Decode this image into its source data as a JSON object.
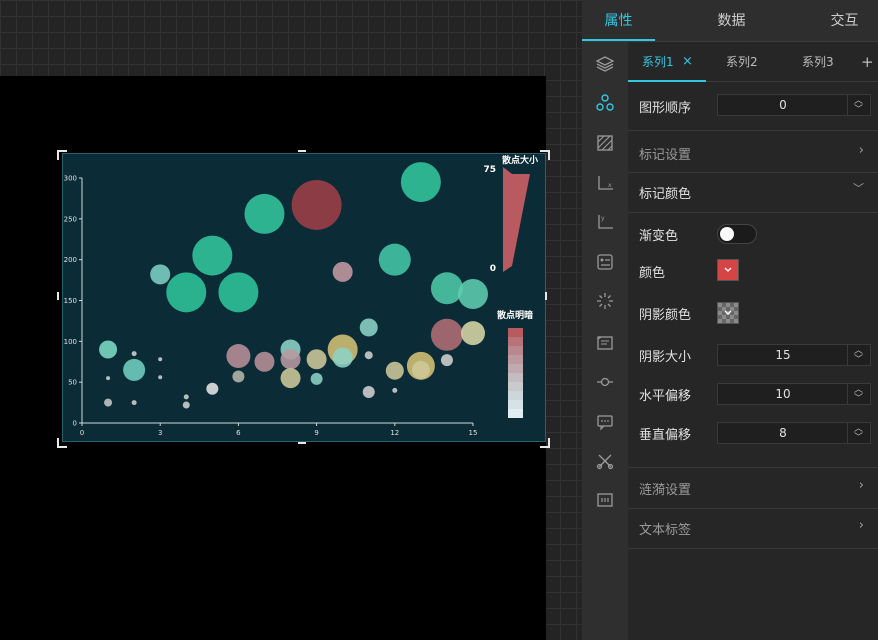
{
  "panel": {
    "tabs": [
      "属性",
      "数据",
      "交互"
    ],
    "series_tabs": [
      "系列1",
      "系列2",
      "系列3"
    ],
    "series_close": "×",
    "series_add": "+",
    "rows": {
      "order_label": "图形顺序",
      "order_value": "0",
      "mark_settings": "标记设置",
      "mark_color": "标记颜色",
      "gradient": "渐变色",
      "color": "颜色",
      "shadow_color": "阴影颜色",
      "shadow_size": "阴影大小",
      "shadow_size_value": "15",
      "h_offset": "水平偏移",
      "h_offset_value": "10",
      "v_offset": "垂直偏移",
      "v_offset_value": "8",
      "ripple": "涟漪设置",
      "text_label": "文本标签"
    },
    "colors": {
      "accent": "#33c6e0",
      "mark_color": "#d64545"
    },
    "icons": [
      "layers-icon",
      "scatter-icon",
      "texture-icon",
      "x-axis-icon",
      "y-axis-icon",
      "legend-icon",
      "loading-icon",
      "tooltip-icon",
      "slider-icon",
      "message-icon",
      "tools-icon",
      "table-icon"
    ]
  },
  "chart_data": {
    "type": "scatter",
    "xlim": [
      0,
      15
    ],
    "ylim": [
      0,
      300
    ],
    "x_ticks": [
      "0",
      "3",
      "6",
      "9",
      "12",
      "15"
    ],
    "y_ticks": [
      "0",
      "50",
      "100",
      "150",
      "200",
      "250",
      "300"
    ],
    "size_legend": {
      "title": "散点大小",
      "max": "75",
      "min": "0"
    },
    "shade_legend": {
      "title": "散点明暗"
    },
    "points": [
      {
        "x": 1,
        "y": 90,
        "size": 18,
        "color": "#7dd9c6"
      },
      {
        "x": 1,
        "y": 25,
        "size": 8,
        "color": "#c6c6c6"
      },
      {
        "x": 1,
        "y": 55,
        "size": 4,
        "color": "#d0d0d0"
      },
      {
        "x": 2,
        "y": 85,
        "size": 5,
        "color": "#d0d0d0"
      },
      {
        "x": 2,
        "y": 65,
        "size": 22,
        "color": "#6fd0c0"
      },
      {
        "x": 2,
        "y": 25,
        "size": 5,
        "color": "#d0d0d0"
      },
      {
        "x": 3,
        "y": 182,
        "size": 20,
        "color": "#7dd0c6"
      },
      {
        "x": 3,
        "y": 78,
        "size": 4,
        "color": "#d0d0d0"
      },
      {
        "x": 3,
        "y": 56,
        "size": 4,
        "color": "#d0d0d0"
      },
      {
        "x": 4,
        "y": 160,
        "size": 40,
        "color": "#2fc49a"
      },
      {
        "x": 4,
        "y": 32,
        "size": 5,
        "color": "#d0d0d0"
      },
      {
        "x": 4,
        "y": 22,
        "size": 7,
        "color": "#d0d0d0"
      },
      {
        "x": 5,
        "y": 205,
        "size": 40,
        "color": "#33c69e"
      },
      {
        "x": 5,
        "y": 42,
        "size": 12,
        "color": "#e6e6e6"
      },
      {
        "x": 6,
        "y": 160,
        "size": 40,
        "color": "#2fc49a"
      },
      {
        "x": 6,
        "y": 82,
        "size": 24,
        "color": "#b88f98"
      },
      {
        "x": 6,
        "y": 57,
        "size": 12,
        "color": "#b6b6aa"
      },
      {
        "x": 7,
        "y": 256,
        "size": 40,
        "color": "#33c69e"
      },
      {
        "x": 7,
        "y": 75,
        "size": 20,
        "color": "#b88f98"
      },
      {
        "x": 8,
        "y": 90,
        "size": 20,
        "color": "#8dd3c6"
      },
      {
        "x": 8,
        "y": 78,
        "size": 20,
        "color": "#b89aa0"
      },
      {
        "x": 8,
        "y": 55,
        "size": 20,
        "color": "#cfc89a"
      },
      {
        "x": 9,
        "y": 267,
        "size": 50,
        "color": "#9e3f48"
      },
      {
        "x": 9,
        "y": 78,
        "size": 20,
        "color": "#cfc89a"
      },
      {
        "x": 9,
        "y": 54,
        "size": 12,
        "color": "#8dd3c6"
      },
      {
        "x": 10,
        "y": 185,
        "size": 20,
        "color": "#c59aa4"
      },
      {
        "x": 10,
        "y": 90,
        "size": 30,
        "color": "#d4c275"
      },
      {
        "x": 10,
        "y": 80,
        "size": 20,
        "color": "#8dd3c6"
      },
      {
        "x": 11,
        "y": 117,
        "size": 18,
        "color": "#8dd3c6"
      },
      {
        "x": 11,
        "y": 83,
        "size": 8,
        "color": "#d0d0d0"
      },
      {
        "x": 11,
        "y": 38,
        "size": 12,
        "color": "#d0d0d0"
      },
      {
        "x": 12,
        "y": 200,
        "size": 32,
        "color": "#44c6a8"
      },
      {
        "x": 12,
        "y": 64,
        "size": 18,
        "color": "#cfc89a"
      },
      {
        "x": 12,
        "y": 40,
        "size": 5,
        "color": "#d0d0d0"
      },
      {
        "x": 13,
        "y": 295,
        "size": 40,
        "color": "#33c69e"
      },
      {
        "x": 13,
        "y": 70,
        "size": 28,
        "color": "#d4c275"
      },
      {
        "x": 13,
        "y": 65,
        "size": 18,
        "color": "#cfc89a"
      },
      {
        "x": 14,
        "y": 165,
        "size": 32,
        "color": "#4ecaa8"
      },
      {
        "x": 14,
        "y": 108,
        "size": 32,
        "color": "#b26e78"
      },
      {
        "x": 14,
        "y": 77,
        "size": 12,
        "color": "#d0d0d0"
      },
      {
        "x": 15,
        "y": 158,
        "size": 30,
        "color": "#5ecdb0"
      },
      {
        "x": 15,
        "y": 110,
        "size": 24,
        "color": "#d8d6a6"
      }
    ]
  }
}
